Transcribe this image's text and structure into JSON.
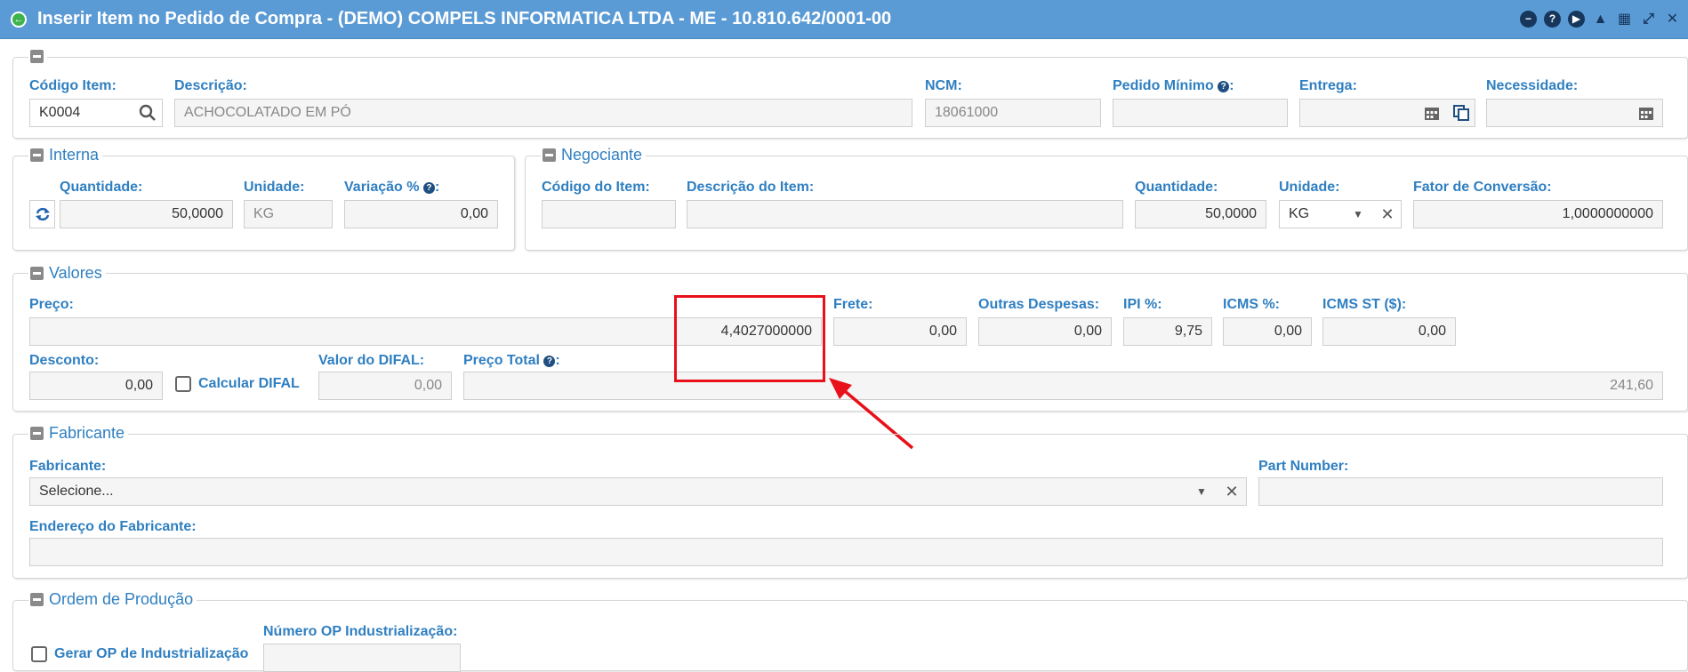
{
  "window": {
    "title": "Inserir Item no Pedido de Compra - (DEMO) COMPELS INFORMATICA LTDA - ME - 10.810.642/0001-00",
    "buttons": [
      "minimize-icon",
      "help-icon",
      "play-icon",
      "bell-icon",
      "calendar-icon",
      "shrink-icon",
      "close-icon"
    ]
  },
  "item": {
    "codigo_label": "Código Item:",
    "codigo_value": "K0004",
    "descricao_label": "Descrição:",
    "descricao_value": "ACHOCOLATADO EM PÓ",
    "ncm_label": "NCM:",
    "ncm_value": "18061000",
    "pedido_minimo_label": "Pedido Mínimo",
    "entrega_label": "Entrega:",
    "necessidade_label": "Necessidade:"
  },
  "interna": {
    "legend": "Interna",
    "quantidade_label": "Quantidade:",
    "quantidade_value": "50,0000",
    "unidade_label": "Unidade:",
    "unidade_value": "KG",
    "variacao_label": "Variação %",
    "variacao_value": "0,00"
  },
  "negociante": {
    "legend": "Negociante",
    "codigo_label": "Código do Item:",
    "descricao_label": "Descrição do Item:",
    "quantidade_label": "Quantidade:",
    "quantidade_value": "50,0000",
    "unidade_label": "Unidade:",
    "unidade_value": "KG",
    "fator_label": "Fator de Conversão:",
    "fator_value": "1,0000000000"
  },
  "valores": {
    "legend": "Valores",
    "preco_label": "Preço:",
    "preco_value": "4,4027000000",
    "frete_label": "Frete:",
    "frete_value": "0,00",
    "outras_label": "Outras Despesas:",
    "outras_value": "0,00",
    "ipi_label": "IPI %:",
    "ipi_value": "9,75",
    "icms_label": "ICMS %:",
    "icms_value": "0,00",
    "icms_st_label": "ICMS ST ($):",
    "icms_st_value": "0,00",
    "desconto_label": "Desconto:",
    "desconto_value": "0,00",
    "calcular_difal_label": "Calcular DIFAL",
    "difal_label": "Valor do DIFAL:",
    "difal_value": "0,00",
    "preco_total_label": "Preço Total",
    "preco_total_value": "241,60"
  },
  "fabricante": {
    "legend": "Fabricante",
    "fabricante_label": "Fabricante:",
    "fabricante_placeholder": "Selecione...",
    "part_number_label": "Part Number:",
    "endereco_label": "Endereço do Fabricante:"
  },
  "ordem": {
    "legend": "Ordem de Produção",
    "gerar_op_label": "Gerar OP de Industrialização",
    "numero_op_label": "Número OP Industrialização:"
  },
  "colors": {
    "titlebar": "#5b9bd5",
    "label": "#2f7fc1",
    "highlight": "#e8101a"
  }
}
